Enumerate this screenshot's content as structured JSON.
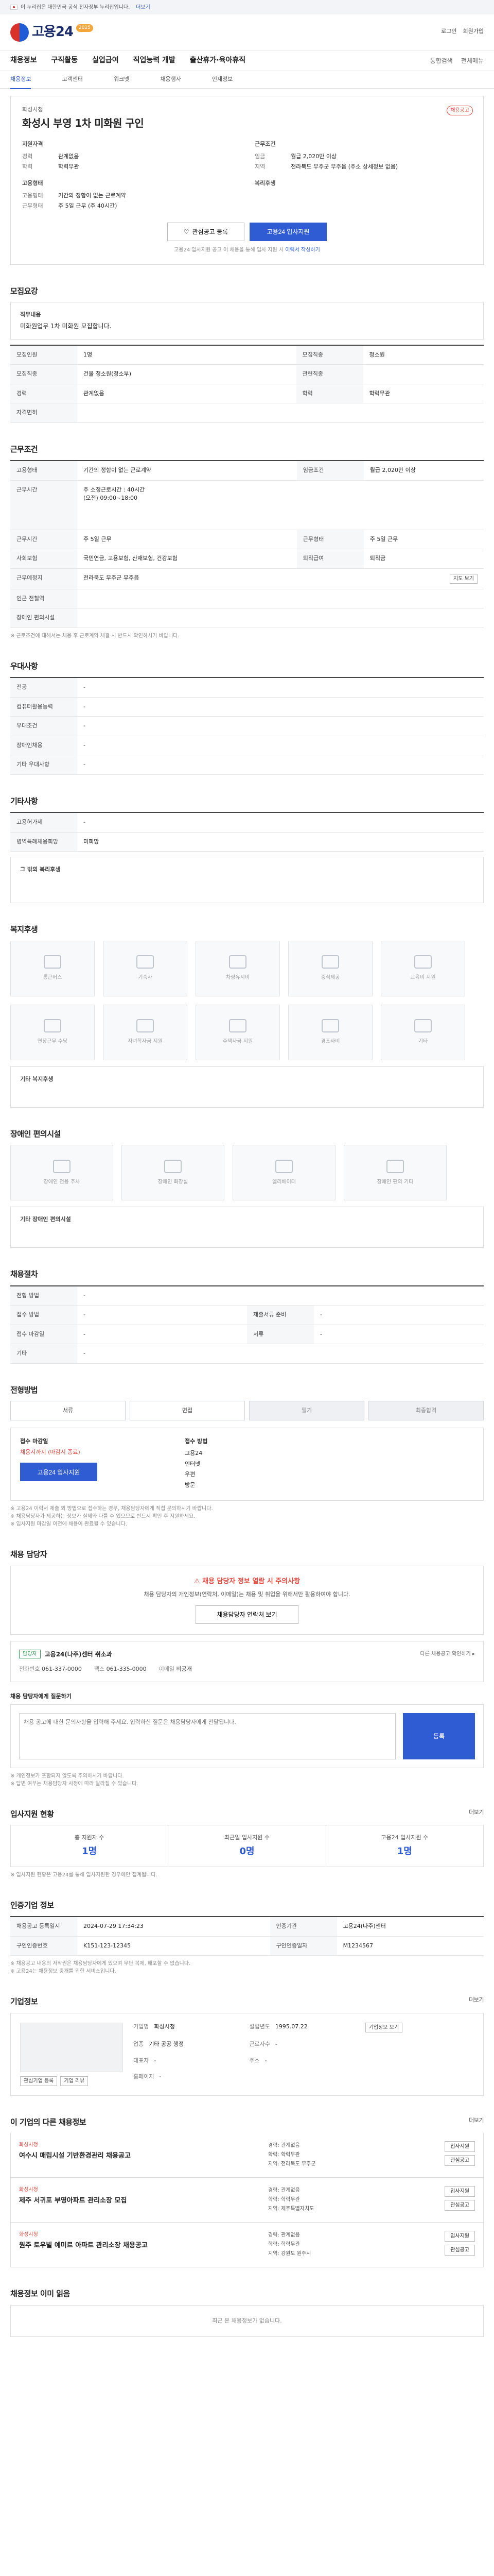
{
  "gov_bar": {
    "text": "이 누리집은 대한민국 공식 전자정부 누리집입니다.",
    "more": "더보기"
  },
  "header": {
    "logo_text": "고용24",
    "logo_tag": "2025",
    "login": "로그인",
    "join": "회원가입",
    "gnb": [
      "채용정보",
      "구직활동",
      "실업급여",
      "직업능력 개발",
      "출산휴가·육아휴직"
    ],
    "gnb_right": [
      "통합검색",
      "전체메뉴"
    ],
    "sub_tabs": [
      "채용정보",
      "고객센터",
      "워크넷",
      "채용행사",
      "인재정보"
    ]
  },
  "summary": {
    "company": "화성시청",
    "title": "화성시 부영 1차 미화원 구인",
    "badge": "채용공고",
    "left_heading": "지원자격",
    "left": [
      {
        "k": "경력",
        "v": "관계없음"
      },
      {
        "k": "학력",
        "v": "학력무관"
      }
    ],
    "right_heading": "근무조건",
    "right": [
      {
        "k": "임금",
        "v": "월급 2,020만 이상"
      },
      {
        "k": "지역",
        "v": "전라북도 무주군 무주읍 (주소 상세정보 없음)"
      }
    ],
    "left2_heading": "고용형태",
    "left2": [
      {
        "k": "고용형태",
        "v": "기간의 정함이 없는 근로계약"
      },
      {
        "k": "근무형태",
        "v": "주 5일 근무 (주 40시간)"
      }
    ],
    "right2_heading": "복리후생",
    "btn_interest": "관심공고 등록",
    "btn_apply": "고용24 입사지원",
    "note": "고용24 입사지원 공고 이 채용을 통해 입사 지원 시 ",
    "note_link": "이력서 작성하기"
  },
  "sections": {
    "recruit_title": "모집요강",
    "duty_label": "직무내용",
    "duty_text": "미화원업무 1차 미화원 모집합니다.",
    "recruit_rows": [
      {
        "k": "모집인원",
        "v": "1명",
        "k2": "모집직종",
        "v2": "청소원"
      },
      {
        "k": "모집직종",
        "v": "건물 청소원(청소부)",
        "k2": "관련직종",
        "v2": ""
      },
      {
        "k": "경력",
        "v": "관계없음",
        "k2": "학력",
        "v2": "학력무관"
      },
      {
        "k": "자격면허",
        "v": "",
        "k2": "",
        "v2": ""
      }
    ],
    "cond_title": "근무조건",
    "cond_rows": [
      {
        "k": "고용형태",
        "v": "기간의 정함이 없는 근로계약",
        "k2": "임금조건",
        "v2": "월급 2,020만 이상"
      },
      {
        "k": "근무시간",
        "v": "주 소정근로시간 : 40시간\n(오전) 09:00~18:00",
        "k2": "",
        "v2": ""
      },
      {
        "k": "근무시간",
        "v": "주 5일 근무",
        "k2": "근무형태",
        "v2": "주 5일 근무"
      },
      {
        "k": "사회보험",
        "v": "국민연금, 고용보험, 산재보험, 건강보험",
        "k2": "퇴직급여",
        "v2": "퇴직금"
      },
      {
        "k": "근무예정지",
        "v": "전라북도 무주군 무주읍",
        "k2": "",
        "v2": ""
      },
      {
        "k": "인근 전철역",
        "v": "",
        "k2": "",
        "v2": ""
      },
      {
        "k": "장애인 편의시설",
        "v": "",
        "k2": "",
        "v2": ""
      }
    ],
    "cond_note": "※ 근로조건에 대해서는 채용 후 근로계약 체결 시 반드시 확인하시기 바랍니다.",
    "pref_title": "우대사항",
    "pref_rows": [
      {
        "k": "전공",
        "v": "-"
      },
      {
        "k": "컴퓨터활용능력",
        "v": "-"
      },
      {
        "k": "우대조건",
        "v": "-"
      },
      {
        "k": "장애인채용",
        "v": "-"
      },
      {
        "k": "기타 우대사항",
        "v": "-"
      }
    ],
    "etc_title": "기타사항",
    "etc_rows": [
      {
        "k": "고용허가제",
        "v": "-"
      },
      {
        "k": "병역특례채용희망",
        "v": "미희망"
      }
    ],
    "etc_box_label": "그 밖의 복리후생",
    "welfare_title": "복지후생",
    "welfare_items": [
      "통근버스",
      "기숙사",
      "차량유지비",
      "중식제공",
      "교육비 지원",
      "연장근무 수당",
      "자녀학자금 지원",
      "주택자금 지원",
      "경조사비",
      "기타"
    ],
    "welfare_other_label": "기타 복지후생",
    "disabled_title": "장애인 편의시설",
    "disabled_items": [
      "장애인 전용 주차",
      "장애인 화장실",
      "엘리베이터",
      "장애인 편의 기타"
    ],
    "disabled_other_label": "기타 장애인 편의시설",
    "contract_title": "채용절차",
    "contract_rows": [
      {
        "k": "전형 방법",
        "v": "-",
        "k2": "",
        "v2": ""
      },
      {
        "k": "접수 방법",
        "v": "-",
        "k2": "제출서류 준비",
        "v2": "-"
      },
      {
        "k": "접수 마감일",
        "v": "-",
        "k2": "서류",
        "v2": "-"
      },
      {
        "k": "기타",
        "v": "-",
        "k2": "",
        "v2": ""
      }
    ],
    "process_title": "전형방법",
    "process_steps": [
      "서류",
      "면접",
      "필기",
      "최종합격"
    ],
    "apply_head": "접수 마감일",
    "apply_red": "채용시까지 (마감시 종료)",
    "apply_btn": "고용24 입사지원",
    "apply_right_head": "접수 방법",
    "apply_right": [
      "고용24",
      "인터넷",
      "우편",
      "방문"
    ],
    "apply_notes": [
      "※ 고용24 이력서 제출 외 방법으로 접수하는 경우, 채용담당자에게 직접 문의하시기 바랍니다.",
      "※ 채용담당자가 제공하는 정보가 실제와 다를 수 있으므로 반드시 확인 후 지원하세요.",
      "※ 입사지원 마감일 이전에 채용이 완료될 수 있습니다."
    ],
    "contact_title": "채용 담당자",
    "contact_warn": "채용 담당자 정보 열람 시 주의사항",
    "contact_text": "채용 담당자의 개인정보(연락처, 이메일)는 채용 및 취업을 위해서만 활용하여야 합니다.",
    "contact_btn": "채용담당자 연락처 보기",
    "contact_tag": "담당자",
    "contact_name": "고용24(나주)센터 취소과",
    "contact_right": "다른 채용공고 확인하기 ▸",
    "contact_rows": [
      {
        "k": "전화번호",
        "v": "061-337-0000"
      },
      {
        "k": "팩스",
        "v": "061-335-0000"
      },
      {
        "k": "이메일",
        "v": "비공개"
      }
    ],
    "qna_title": "채용 담당자에게 질문하기",
    "qna_placeholder": "채용 공고에 대한 문의사항을 입력해 주세요. 입력하신 질문은 채용담당자에게 전달됩니다.",
    "qna_btn": "등록",
    "qna_notes": [
      "※ 개인정보가 포함되지 않도록 주의하시기 바랍니다.",
      "※ 답변 여부는 채용담당자 사정에 따라 달라질 수 있습니다."
    ],
    "stats_title": "입사지원 현황",
    "stats_more": "더보기",
    "stats": [
      {
        "k": "총 지원자 수",
        "v": "1명"
      },
      {
        "k": "최근일 입사지원 수",
        "v": "0명"
      },
      {
        "k": "고용24 입사지원 수",
        "v": "1명"
      }
    ],
    "stats_note": "※ 입사지원 현황은 고용24를 통해 입사지원한 경우에만 집계됩니다.",
    "info_title": "인증기업 정보",
    "info_rows": [
      {
        "k": "채용공고 등록일시",
        "v": "2024-07-29 17:34:23",
        "k2": "인증기관",
        "v2": "고용24(나주)센터"
      },
      {
        "k": "구인인증번호",
        "v": "K151-123-12345",
        "k2": "구인인증일자",
        "v2": "M1234567"
      }
    ],
    "info_notes": [
      "※ 채용공고 내용의 저작권은 채용담당자에게 있으며 무단 복제, 배포할 수 없습니다.",
      "※ 고용24는 채용정보 중개를 위한 서비스입니다."
    ],
    "company_title": "기업정보",
    "company_more": "더보기",
    "company_rows": [
      {
        "k": "기업명",
        "v": "화성시청",
        "k2": "설립년도",
        "v2": "1995.07.22"
      },
      {
        "k": "업종",
        "v": "기타 공공 행정",
        "k2": "근로자수",
        "v2": "-"
      },
      {
        "k": "대표자",
        "v": "-",
        "k2": "주소",
        "v2": "-"
      },
      {
        "k": "홈페이지",
        "v": "-",
        "k2": "",
        "v2": ""
      }
    ],
    "company_btn": "기업정보 보기",
    "company_btns": [
      "관심기업 등록",
      "기업 리뷰"
    ],
    "jobs_title": "이 기업의 다른 채용정보",
    "jobs_more": "더보기",
    "jobs": [
      {
        "company": "화성시청",
        "title": "여수시 매립시설 기반환경관리 채용공고",
        "meta": [
          "경력: 관계없음",
          "학력: 학력무관",
          "지역: 전라북도 무주군"
        ],
        "acts": [
          "입사지원",
          "관심공고"
        ]
      },
      {
        "company": "화성시청",
        "title": "제주 서귀포 부영아파트 관리소장 모집",
        "meta": [
          "경력: 관계없음",
          "학력: 학력무관",
          "지역: 제주특별자치도"
        ],
        "acts": [
          "입사지원",
          "관심공고"
        ]
      },
      {
        "company": "화성시청",
        "title": "원주 토우빌 예미르 아파트 관리소장 채용공고",
        "meta": [
          "경력: 관계없음",
          "학력: 학력무관",
          "지역: 강원도 원주시"
        ],
        "acts": [
          "입사지원",
          "관심공고"
        ]
      }
    ],
    "recent_title": "채용정보 이미 읽음",
    "recent_empty": "최근 본 채용정보가 없습니다."
  }
}
